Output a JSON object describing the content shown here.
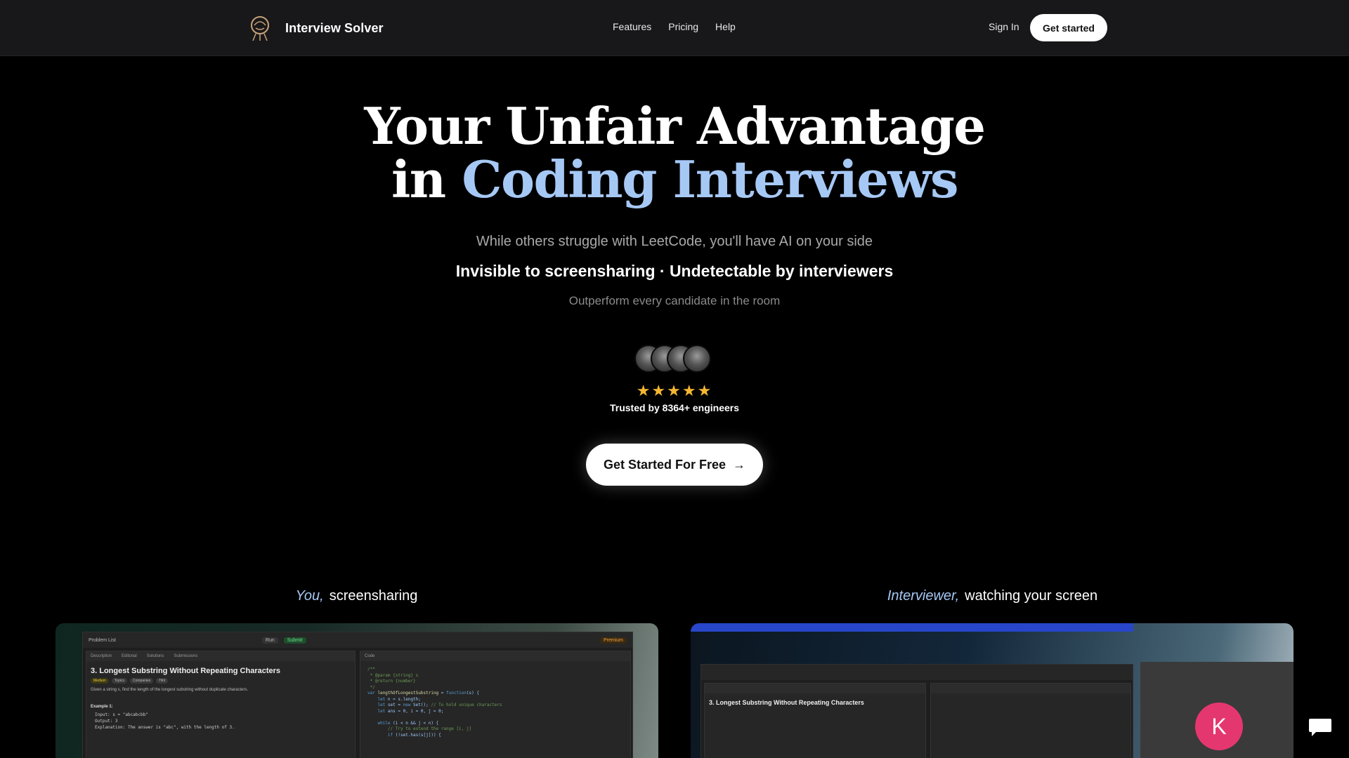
{
  "nav": {
    "brand": "Interview Solver",
    "links": [
      "Features",
      "Pricing",
      "Help"
    ],
    "sign_in": "Sign In",
    "get_started": "Get started"
  },
  "hero": {
    "title_line1": "Your Unfair Advantage",
    "title_line2_prefix": "in ",
    "title_line2_accent": "Coding Interviews",
    "subtitle": "While others struggle with LeetCode, you'll have AI on your side",
    "tagline": "Invisible to screensharing · Undetectable by interviewers",
    "note": "Outperform every candidate in the room",
    "stars": "★★★★★",
    "rating_stars": 5,
    "trusted": "Trusted by 8364+ engineers",
    "cta": "Get Started For Free"
  },
  "previews": {
    "left": {
      "caption_em": "You,",
      "caption": "screensharing",
      "toolbar": {
        "problem_list": "Problem List",
        "run": "Run",
        "submit": "Submit",
        "premium": "Premium"
      },
      "tabs": [
        "Description",
        "Editorial",
        "Solutions",
        "Submissions"
      ],
      "code_tab": "Code",
      "problem_title": "3. Longest Substring Without Repeating Characters",
      "tags": [
        "Medium",
        "Topics",
        "Companies",
        "Hint"
      ],
      "description": "Given a string s, find the length of the longest substring without duplicate characters.",
      "example_label": "Example 1:",
      "example": "Input: s = \"abcabcbb\"\nOutput: 3\nExplanation: The answer is \"abc\", with the length of 3."
    },
    "right": {
      "caption_em": "Interviewer,",
      "caption": "watching your screen",
      "problem_title": "3. Longest Substring Without Repeating Characters",
      "avatar_letter": "K"
    }
  },
  "colors": {
    "accent": "#a6c8f5",
    "star": "#f5b731",
    "avatar_k": "#e5376f"
  }
}
